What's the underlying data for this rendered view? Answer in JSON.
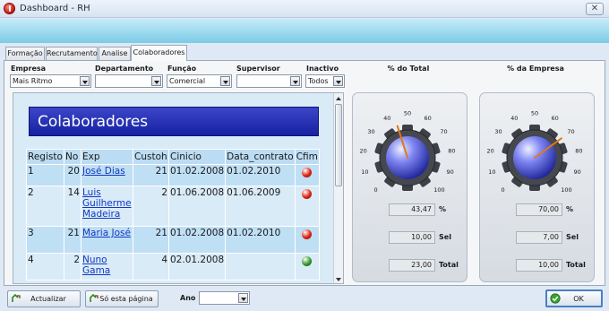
{
  "window": {
    "title": "Dashboard - RH",
    "close_label": "✕"
  },
  "tabs": [
    {
      "label": "Formação"
    },
    {
      "label": "Recrutamento"
    },
    {
      "label": "Analise"
    },
    {
      "label": "Colaboradores",
      "active": true
    }
  ],
  "filters": {
    "empresa": {
      "label": "Empresa",
      "value": "Mais Ritmo"
    },
    "departamento": {
      "label": "Departamento",
      "value": ""
    },
    "funcao": {
      "label": "Função",
      "value": "Comercial"
    },
    "supervisor": {
      "label": "Supervisor",
      "value": ""
    },
    "inactivo": {
      "label": "Inactivo",
      "value": "Todos"
    }
  },
  "report": {
    "title": "Colaboradores",
    "columns": [
      "Registo",
      "No",
      "Exp",
      "Custoh",
      "Cinicio",
      "Data_contrato",
      "Cfim"
    ],
    "rows": [
      {
        "registo": "1",
        "no": "20",
        "exp": "José Dias",
        "custoh": "21",
        "cinicio": "01.02.2008",
        "data_contrato": "01.02.2010",
        "cfim": "red"
      },
      {
        "registo": "2",
        "no": "14",
        "exp": "Luis Guilherme Madeira",
        "custoh": "2",
        "cinicio": "01.06.2008",
        "data_contrato": "01.06.2009",
        "cfim": "red"
      },
      {
        "registo": "3",
        "no": "21",
        "exp": "Maria José",
        "custoh": "21",
        "cinicio": "01.02.2008",
        "data_contrato": "01.02.2010",
        "cfim": "red"
      },
      {
        "registo": "4",
        "no": "2",
        "exp": "Nuno Gama",
        "custoh": "4",
        "cinicio": "02.01.2008",
        "data_contrato": "",
        "cfim": "green"
      }
    ]
  },
  "gauges": [
    {
      "heading": "% do Total",
      "value": 43.47,
      "ticks": [
        "0",
        "10",
        "20",
        "30",
        "40",
        "50",
        "60",
        "70",
        "80",
        "90",
        "100"
      ],
      "pct_value": "43,47",
      "pct_label": "%",
      "sel_value": "10,00",
      "sel_label": "Sel",
      "total_value": "23,00",
      "total_label": "Total"
    },
    {
      "heading": "% da Empresa",
      "value": 70,
      "ticks": [
        "0",
        "10",
        "20",
        "30",
        "40",
        "50",
        "60",
        "70",
        "80",
        "90",
        "100"
      ],
      "pct_value": "70,00",
      "pct_label": "%",
      "sel_value": "7,00",
      "sel_label": "Sel",
      "total_value": "10,00",
      "total_label": "Total"
    }
  ],
  "bottom": {
    "actualizar_label": "Actualizar",
    "so_esta_pagina_label": "Só esta página",
    "ano_label": "Ano",
    "ano_value": "",
    "ok_label": "OK"
  },
  "colors": {
    "banner_top": "#c4ecf8",
    "banner_bottom": "#7ccbe6",
    "report_title_bg": "#2a35b8",
    "status_red": "#e02010",
    "status_green": "#2f9a2a",
    "needle": "#e07818"
  },
  "icons": {
    "app": "app-power-icon",
    "close": "close-icon",
    "actualizar": "refresh-icon",
    "so_esta_pagina": "page-icon",
    "ok": "check-icon"
  }
}
